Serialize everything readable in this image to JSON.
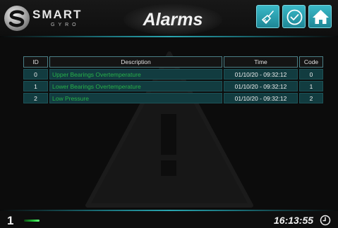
{
  "header": {
    "logo_text": "SMART",
    "logo_sub": "GYRO",
    "title": "Alarms",
    "buttons": [
      {
        "name": "reset-alarms-button",
        "icon": "broom-icon"
      },
      {
        "name": "acknowledge-button",
        "icon": "check-circle-icon"
      },
      {
        "name": "home-button",
        "icon": "home-icon"
      }
    ]
  },
  "table": {
    "headers": {
      "id": "ID",
      "description": "Description",
      "time": "Time",
      "code": "Code"
    },
    "rows": [
      {
        "id": "0",
        "description": "Upper Bearings Overtemperature",
        "time": "01/10/20 - 09:32:12",
        "code": "0"
      },
      {
        "id": "1",
        "description": "Lower Bearings Overtemperature",
        "time": "01/10/20 - 09:32:12",
        "code": "1"
      },
      {
        "id": "2",
        "description": "Low Pressure",
        "time": "01/10/20 - 09:32:12",
        "code": "2"
      }
    ]
  },
  "footer": {
    "page_number": "1",
    "clock": "16:13:55"
  },
  "colors": {
    "accent": "#2aa6b0",
    "button": "#2ba5b5",
    "alarm_text": "#27b24a",
    "row_bg": "#123c40"
  }
}
